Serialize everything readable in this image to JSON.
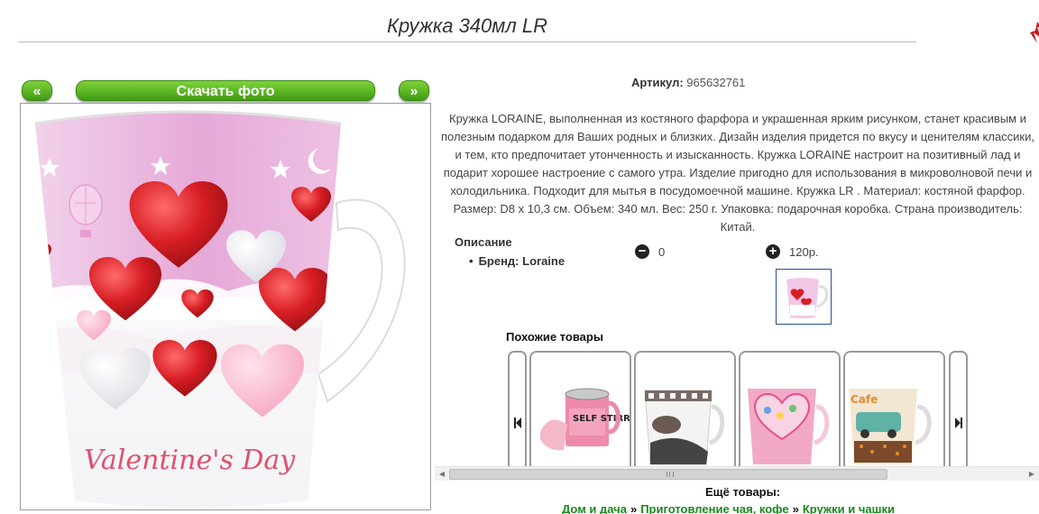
{
  "product": {
    "title": "Кружка 340мл LR",
    "article_label": "Артикул:",
    "article_value": "965632761",
    "description": "Кружка LORAINE, выполненная из костяного фарфора и украшенная ярким рисунком, станет красивым и полезным подарком для Ваших родных и близких. Дизайн изделия придется по вкусу и ценителям классики, и тем, кто предпочитает утонченность и изысканность. Кружка LORAINE настроит на позитивный лад и подарит хорошее настроение с самого утра. Изделие пригодно для использования в микроволновой печи и холодильника. Подходит для мытья в посудомоечной машине. Кружка LR . Материал: костяной фарфор. Размер: D8 х 10,3 см. Объем: 340 мл. Вес: 250 г. Упаковка: подарочная коробка. Страна производитель: Китай.",
    "props_heading": "Описание",
    "brand_label": "Бренд: Loraine",
    "qty_minus_value": "0",
    "price": "120р.",
    "photo_text": "Valentine's Day"
  },
  "photo_nav": {
    "prev_label": "«",
    "download_label": "Скачать фото",
    "next_label": "»"
  },
  "similar": {
    "title": "Похожие товары",
    "cards": [
      {
        "icon": "self-stirring-mug-image",
        "text": "SELF STIRRING MUG"
      },
      {
        "icon": "printed-mug-image"
      },
      {
        "icon": "heart-mug-image"
      },
      {
        "icon": "cafe-car-mug-image",
        "text": "Cafe"
      }
    ]
  },
  "more": {
    "title": "Ещё товары:",
    "breadcrumb": [
      "Дом и дача",
      "Приготовление чая, кофе",
      "Кружки и чашки"
    ],
    "separator": "»"
  },
  "colors": {
    "button_green": "#4caf1b",
    "link_green": "#1a8a1a",
    "heart_red": "#d81e24",
    "mug_pink": "#e8a6d6"
  }
}
